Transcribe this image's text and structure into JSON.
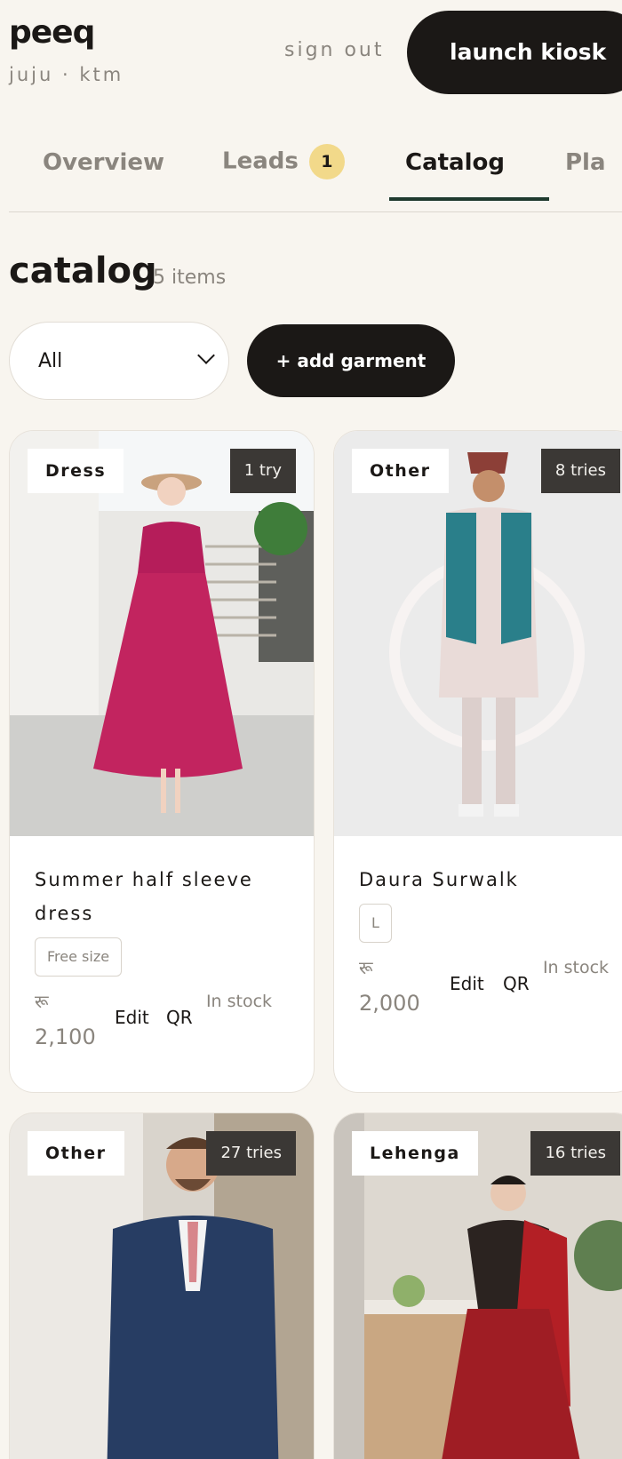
{
  "header": {
    "brand": "peeq",
    "subtitle": "juju · ktm",
    "sign_out": "sign out",
    "launch_kiosk": "launch kiosk"
  },
  "tabs": [
    {
      "label": "Overview",
      "active": false
    },
    {
      "label": "Leads",
      "active": false,
      "badge": "1"
    },
    {
      "label": "Catalog",
      "active": true
    },
    {
      "label": "Pla",
      "active": false
    }
  ],
  "catalog": {
    "title": "catalog",
    "count": "5 items",
    "filter_value": "All",
    "add_label": "+ add garment"
  },
  "items": [
    {
      "category": "Dress",
      "tries": "1 try",
      "name": "Summer half sleeve dress",
      "size": "Free size",
      "currency": "रू",
      "price": "2,100",
      "edit": "Edit",
      "qr": "QR",
      "stock": "In stock"
    },
    {
      "category": "Other",
      "tries": "8 tries",
      "name": "Daura Surwalk",
      "size": "L",
      "currency": "रू",
      "price": "2,000",
      "edit": "Edit",
      "qr": "QR",
      "stock": "In stock"
    },
    {
      "category": "Other",
      "tries": "27 tries"
    },
    {
      "category": "Lehenga",
      "tries": "16 tries"
    }
  ],
  "colors": {
    "background": "#f8f5ef",
    "primary_dark": "#1b1816",
    "muted_text": "#8a857e",
    "badge_yellow": "#f2d98a",
    "tab_underline": "#1f3a2e"
  }
}
